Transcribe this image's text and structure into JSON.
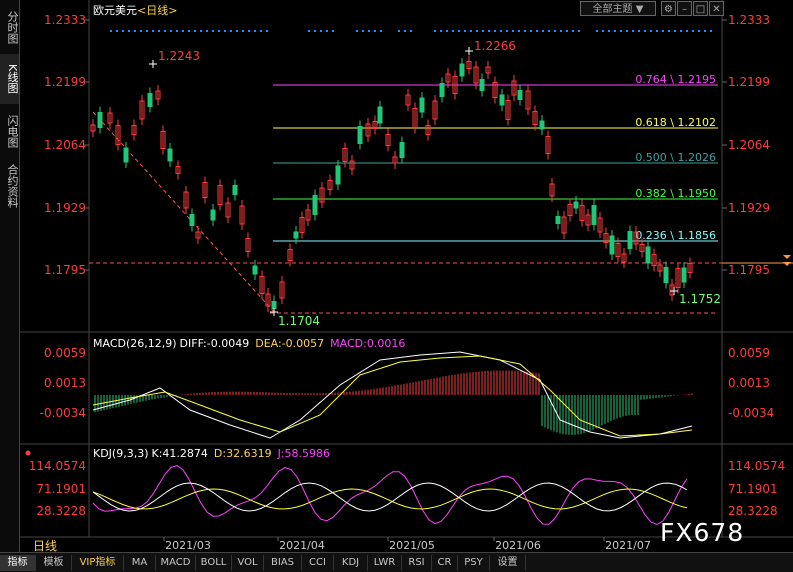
{
  "sidebar": {
    "tabs": [
      {
        "label": "分时图",
        "active": false
      },
      {
        "label": "K线图",
        "active": true
      },
      {
        "label": "闪电图",
        "active": false
      },
      {
        "label": "合约资料",
        "active": false
      }
    ]
  },
  "header": {
    "symbol": "欧元美元",
    "period": "<日线>",
    "theme_select": "全部主题",
    "theme_arrow": "▼"
  },
  "price_axis": {
    "labels": [
      "1.2333",
      "1.2199",
      "1.2064",
      "1.1929",
      "1.1795"
    ],
    "current_price_marker": "1.1795"
  },
  "annotations": {
    "high1": "1.2243",
    "high2": "1.2266",
    "low1": "1.1704",
    "low2": "1.1752"
  },
  "fibonacci": [
    {
      "label": "0.764 \\ 1.2195",
      "color": "#ff40ff"
    },
    {
      "label": "0.618 \\ 1.2102",
      "color": "#ffff40"
    },
    {
      "label": "0.500 \\ 1.2026",
      "color": "#40a0a0"
    },
    {
      "label": "0.382 \\ 1.1950",
      "color": "#40ff40"
    },
    {
      "label": "0.236 \\ 1.1856",
      "color": "#80ffff"
    }
  ],
  "macd": {
    "title": "MACD(26,12,9)",
    "diff": "DIFF:-0.0049",
    "dea": "DEA:-0.0057",
    "macd": "MACD:0.0016",
    "axis_labels": [
      "0.0059",
      "0.0013",
      "-0.0034"
    ]
  },
  "kdj": {
    "title": "KDJ(9,3,3)",
    "k": "K:41.2874",
    "d": "D:32.6319",
    "j": "J:58.5986",
    "axis_labels": [
      "114.0574",
      "71.1901",
      "28.3228"
    ]
  },
  "time_axis": {
    "labels": [
      "2021/03",
      "2021/04",
      "2021/05",
      "2021/06",
      "2021/07"
    ]
  },
  "period_label": "日线",
  "watermark": "FX678",
  "bottom_tabs": [
    "指标",
    "模板",
    "VIP指标",
    "MA",
    "MACD",
    "BOLL",
    "VOL",
    "BIAS",
    "CCI",
    "KDJ",
    "LWR",
    "RSI",
    "CR",
    "PSY",
    "设置"
  ],
  "colors": {
    "up": "#ff3b3b",
    "down": "#1ec878",
    "bg": "#000000",
    "price_label": "#ff3b3b",
    "low_label": "#6cff6c",
    "dot_row": "#1e90ff"
  }
}
